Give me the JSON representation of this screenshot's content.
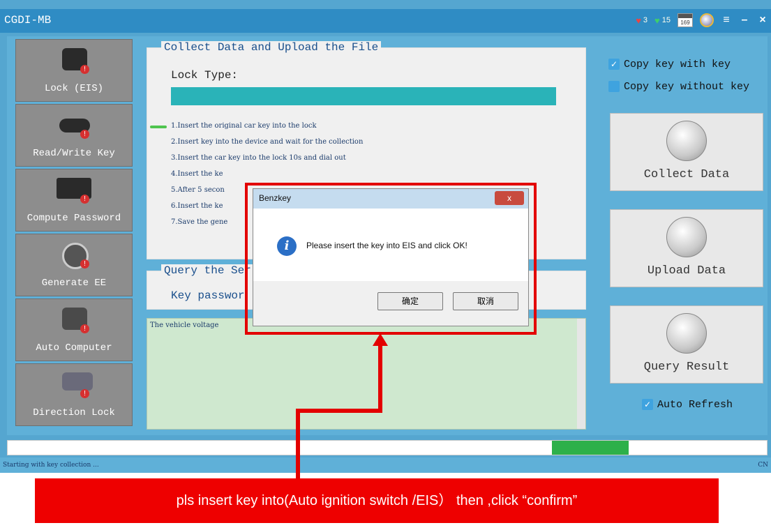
{
  "window": {
    "title": "CGDI-MB",
    "stats": [
      {
        "icon": "heart-red-icon",
        "value": "3"
      },
      {
        "icon": "heart-green-icon",
        "value": "15"
      }
    ],
    "calendar_value": "169"
  },
  "sidebar": {
    "items": [
      {
        "label": "Lock (EIS)",
        "icon": "lock-icon"
      },
      {
        "label": "Read/Write Key",
        "icon": "car-key-icon"
      },
      {
        "label": "Compute Password",
        "icon": "keyboard-icon"
      },
      {
        "label": "Generate EE",
        "icon": "ignition-icon"
      },
      {
        "label": "Auto Computer",
        "icon": "ecu-icon"
      },
      {
        "label": "Direction Lock",
        "icon": "steering-lock-icon"
      }
    ],
    "badge": "!"
  },
  "collect": {
    "legend": "Collect Data and Upload the File",
    "lock_type_label": "Lock Type:",
    "steps": [
      "1.Insert  the original car key into the lock",
      "2.Insert key into the device and wait for the collection",
      "3.Insert the car key into the lock 10s and dial out",
      "4.Insert the ke",
      "5.After 5 secon",
      "6.Insert the ke",
      "7.Save the gene"
    ]
  },
  "query": {
    "legend": "Query the Ser",
    "key_password_label": "Key passwor"
  },
  "log": {
    "text": "The vehicle voltage"
  },
  "options": {
    "copy_with_key": "Copy key with key",
    "copy_without_key": "Copy key without key",
    "auto_refresh": "Auto Refresh",
    "check_mark": "✓"
  },
  "actions": {
    "collect": "Collect Data",
    "upload": "Upload  Data",
    "query": "Query Result"
  },
  "progress": {
    "value": 0.1
  },
  "status": {
    "text": "Starting with key collection ...",
    "lang": "CN"
  },
  "dialog": {
    "title": "Benzkey",
    "close": "x",
    "message": "Please insert the key into EIS and click OK!",
    "ok": "确定",
    "cancel": "取消"
  },
  "annotation": {
    "banner": "pls insert key into(Auto ignition switch /EIS） then ,click “confirm”"
  },
  "colors": {
    "window_bg": "#55a6d0",
    "titlebar": "#2f8cc4",
    "highlight_red": "#e30000",
    "progress_green": "#2db04a",
    "lock_type_bar": "#2ab3b8"
  }
}
